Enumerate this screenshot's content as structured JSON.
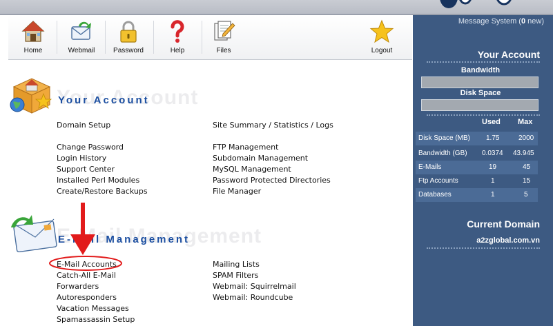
{
  "toolbar": {
    "items": [
      {
        "label": "Home",
        "icon": "home-icon"
      },
      {
        "label": "Webmail",
        "icon": "webmail-icon"
      },
      {
        "label": "Password",
        "icon": "padlock-icon"
      },
      {
        "label": "Help",
        "icon": "question-mark-icon"
      },
      {
        "label": "Files",
        "icon": "files-icon"
      },
      {
        "label": "Logout",
        "icon": "star-icon"
      }
    ]
  },
  "message_system": {
    "prefix": "Message System (",
    "count": "0",
    "suffix": " new)"
  },
  "your_account": {
    "title": "Your Account",
    "ghost": "Your Account",
    "links": {
      "domain_setup": "Domain Setup",
      "site_summary": "Site Summary / Statistics / Logs",
      "change_password": "Change Password",
      "login_history": "Login History",
      "support_center": "Support Center",
      "perl_modules": "Installed Perl Modules",
      "backups": "Create/Restore Backups",
      "ftp": "FTP Management",
      "subdomain": "Subdomain Management",
      "mysql": "MySQL Management",
      "protected_dirs": "Password Protected Directories",
      "file_manager": "File Manager"
    }
  },
  "email_management": {
    "title": "E-Mail Management",
    "ghost": "E-Mail Management",
    "links": {
      "email_accounts": "E-Mail Accounts",
      "catch_all": "Catch-All E-Mail",
      "forwarders": "Forwarders",
      "autoresponders": "Autoresponders",
      "vacation": "Vacation Messages",
      "spamassassin": "Spamassassin Setup",
      "mailing_lists": "Mailing Lists",
      "spam_filters": "SPAM Filters",
      "squirrelmail": "Webmail: Squirrelmail",
      "roundcube": "Webmail: Roundcube"
    }
  },
  "sidebar": {
    "title": "Your Account",
    "bandwidth_label": "Bandwidth",
    "disk_label": "Disk Space",
    "bandwidth_fill": 0,
    "disk_fill": 0,
    "col_used": "Used",
    "col_max": "Max",
    "stats": [
      {
        "label": "Disk Space (MB)",
        "used": "1.75",
        "max": "2000"
      },
      {
        "label": "Bandwidth (GB)",
        "used": "0.0374",
        "max": "43.945"
      },
      {
        "label": "E-Mails",
        "used": "19",
        "max": "45"
      },
      {
        "label": "Ftp Accounts",
        "used": "1",
        "max": "15"
      },
      {
        "label": "Databases",
        "used": "1",
        "max": "5"
      }
    ],
    "current_domain_title": "Current Domain",
    "current_domain": "a2zglobal.com.vn"
  },
  "colors": {
    "sidebar_bg": "#3d5a82",
    "section_title": "#1c4fa1",
    "annotation_red": "#e21b1b"
  }
}
